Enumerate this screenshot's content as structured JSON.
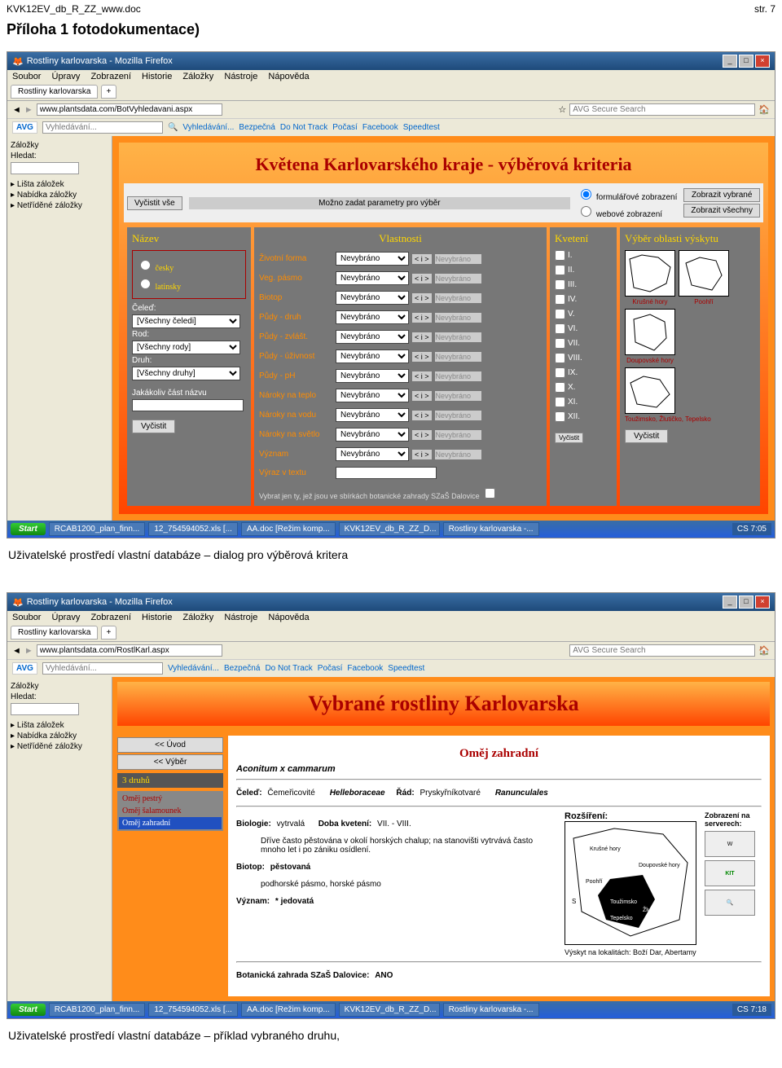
{
  "doc": {
    "filename": "KVK12EV_db_R_ZZ_www.doc",
    "page": "str. 7",
    "heading": "Příloha 1 fotodokumentace)"
  },
  "caption1": "Uživatelské prostředí vlastní databáze – dialog pro výběrová kritera",
  "caption2": "Uživatelské prostředí vlastní databáze – příklad vybraného druhu,",
  "browser": {
    "title": "Rostliny karlovarska - Mozilla Firefox",
    "menu": [
      "Soubor",
      "Úpravy",
      "Zobrazení",
      "Historie",
      "Záložky",
      "Nástroje",
      "Nápověda"
    ],
    "tab": "Rostliny karlovarska",
    "url1": "www.plantsdata.com/BotVyhledavani.aspx",
    "url2": "www.plantsdata.com/RostlKarl.aspx",
    "search_placeholder": "AVG Secure Search",
    "avg_label": "AVG",
    "toolbar_search_placeholder": "Vyhledávání...",
    "toolbar_items": [
      "Vyhledávání...",
      "Bezpečná",
      "Do Not Track",
      "Počasí",
      "Facebook",
      "Speedtest"
    ],
    "bookmark_panel": "Záložky",
    "bookmark_search": "Hledat:",
    "tree": [
      "Lišta záložek",
      "Nabídka záložky",
      "Netříděné záložky"
    ]
  },
  "s1": {
    "title": "Květena Karlovarského kraje - výběrová kriteria",
    "clear": "Vyčistit vše",
    "param_hint": "Možno zadat parametry pro výběr",
    "display_radio": [
      "formulářové zobrazení",
      "webové zobrazení"
    ],
    "show_btns": [
      "Zobrazit vybrané",
      "Zobrazit všechny"
    ],
    "col_names": {
      "n": "Název",
      "v": "Vlastnosti",
      "k": "Kvetení",
      "o": "Výběr oblasti výskytu"
    },
    "name_lang": [
      "česky",
      "latinsky"
    ],
    "name_labels": {
      "celed": "Čeleď:",
      "rod": "Rod:",
      "druh": "Druh:",
      "any": "Jakákoliv část názvu"
    },
    "name_sel": [
      "[Všechny čeledi]",
      "[Všechny rody]",
      "[Všechny druhy]"
    ],
    "props": [
      "Životní forma",
      "Veg. pásmo",
      "Biotop",
      "Půdy - druh",
      "Půdy - zvlášt.",
      "Půdy - úživnost",
      "Půdy - pH",
      "Nároky na teplo",
      "Nároky na vodu",
      "Nároky na světlo",
      "Význam"
    ],
    "prop_default": "Nevybráno",
    "op_lbl": "< i >",
    "vyraz": "Výraz v textu",
    "sbirky": "Vybrat jen ty, jež jsou ve sbírkách botanické zahrady    SZaŠ Dalovice",
    "months": [
      "I.",
      "II.",
      "III.",
      "IV.",
      "V.",
      "VI.",
      "VII.",
      "VIII.",
      "IX.",
      "X.",
      "XI.",
      "XII."
    ],
    "regions": [
      "Krušné hory",
      "Poohří",
      "Doupovské hory",
      "Toužimsko, Žlutičko, Tepelsko"
    ],
    "vyc": "Vyčistit"
  },
  "s2": {
    "title": "Vybrané rostliny Karlovarska",
    "nav": [
      "<< Úvod",
      "<< Výběr"
    ],
    "count": "3 druhů",
    "list": [
      "Oměj pestrý",
      "Oměj šalamounek",
      "Oměj zahradní"
    ],
    "selected": 2,
    "detail": {
      "name": "Oměj zahradní",
      "latin": "Aconitum x cammarum",
      "celed_l": "Čeleď:",
      "celed_cz": "Čemeřicovité",
      "celed_lat": "Helleboraceae",
      "rad_l": "Řád:",
      "rad_cz": "Pryskyřníkotvaré",
      "rad_lat": "Ranunculales",
      "bio_l": "Biologie:",
      "bio_v": "vytrvalá",
      "doba_l": "Doba kvetení:",
      "doba_v": "VII. - VIII.",
      "roz_l": "Rozšíření:",
      "desc": "Dříve často pěstována v okolí horských chalup; na stanovišti vytrvává často mnoho let i po zániku osídlení.",
      "biotop_l": "Biotop:",
      "biotop_v": "pěstovaná",
      "biotop_sub": "podhorské pásmo, horské pásmo",
      "vyznam_l": "Význam:",
      "vyznam_v": "* jedovatá",
      "lokality": "Výskyt na lokalitách: Boží Dar, Abertamy",
      "zahrada_l": "Botanická zahrada SZaŠ Dalovice:",
      "zahrada_v": "ANO",
      "servers_l": "Zobrazení na serverech:",
      "map_labels": [
        "Krušné hory",
        "Poohří",
        "Doupovské hory",
        "Toužimsko",
        "Tepelsko",
        "Žlutičko"
      ]
    }
  },
  "taskbar": {
    "start": "Start",
    "tasks": [
      "RCAB1200_plan_finn...",
      "12_754594052.xls [...",
      "AA.doc [Režim komp...",
      "KVK12EV_db_R_ZZ_D...",
      "Rostliny karlovarska -..."
    ],
    "tray1": "CS   7:05",
    "tray2": "CS   7:18"
  }
}
